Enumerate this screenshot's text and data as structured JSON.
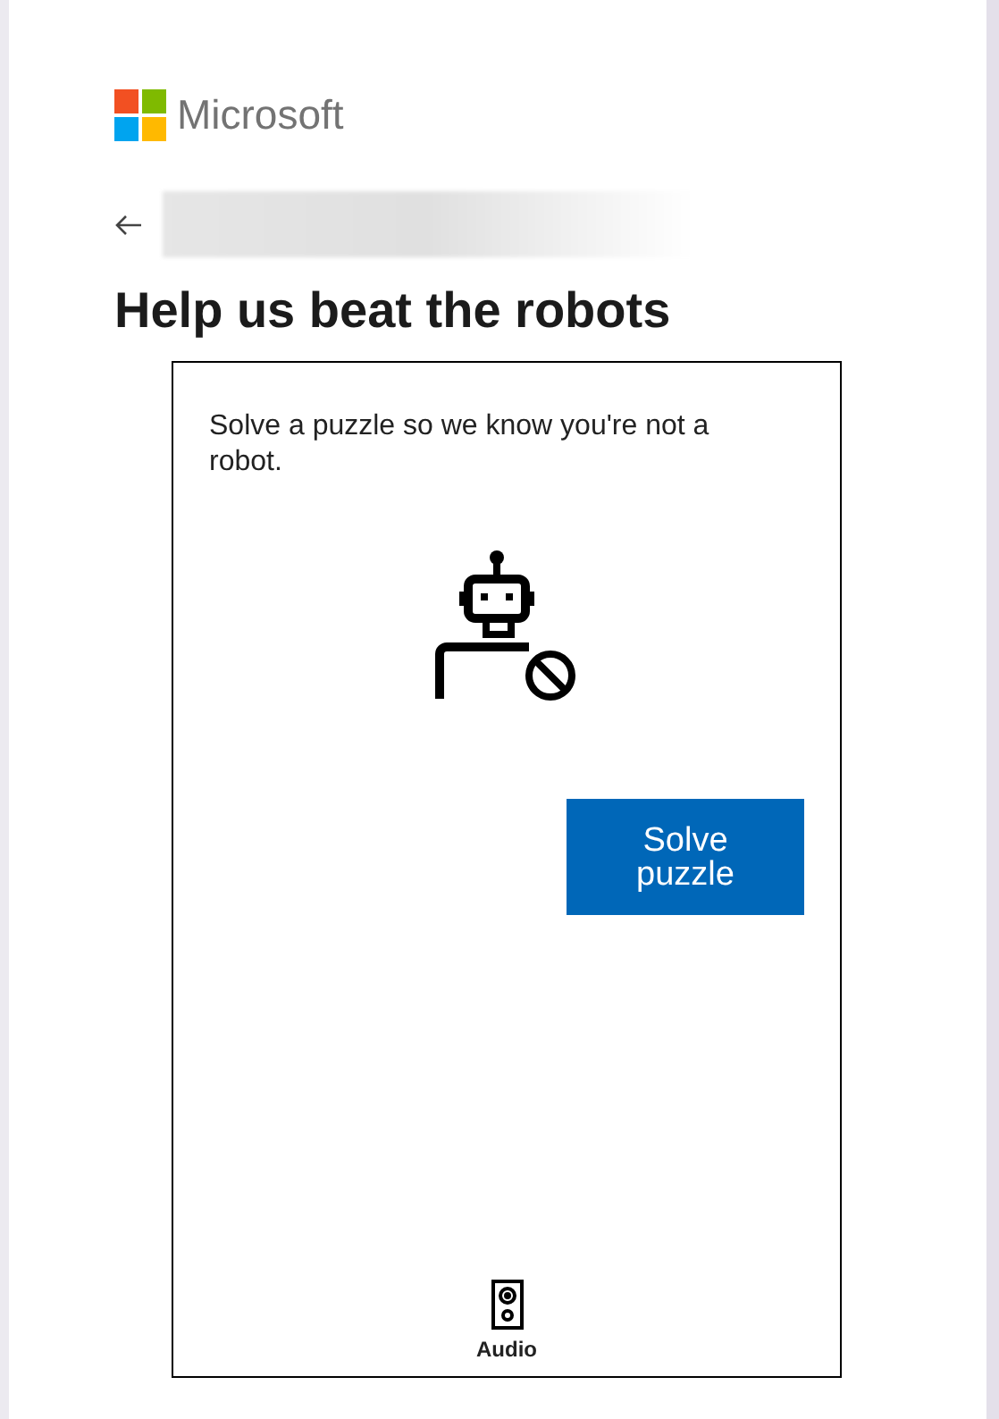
{
  "brand": {
    "name": "Microsoft"
  },
  "heading": "Help us beat the robots",
  "puzzle": {
    "prompt": "Solve a puzzle so we know you're not a robot.",
    "button": "Solve puzzle",
    "audio_label": "Audio"
  }
}
